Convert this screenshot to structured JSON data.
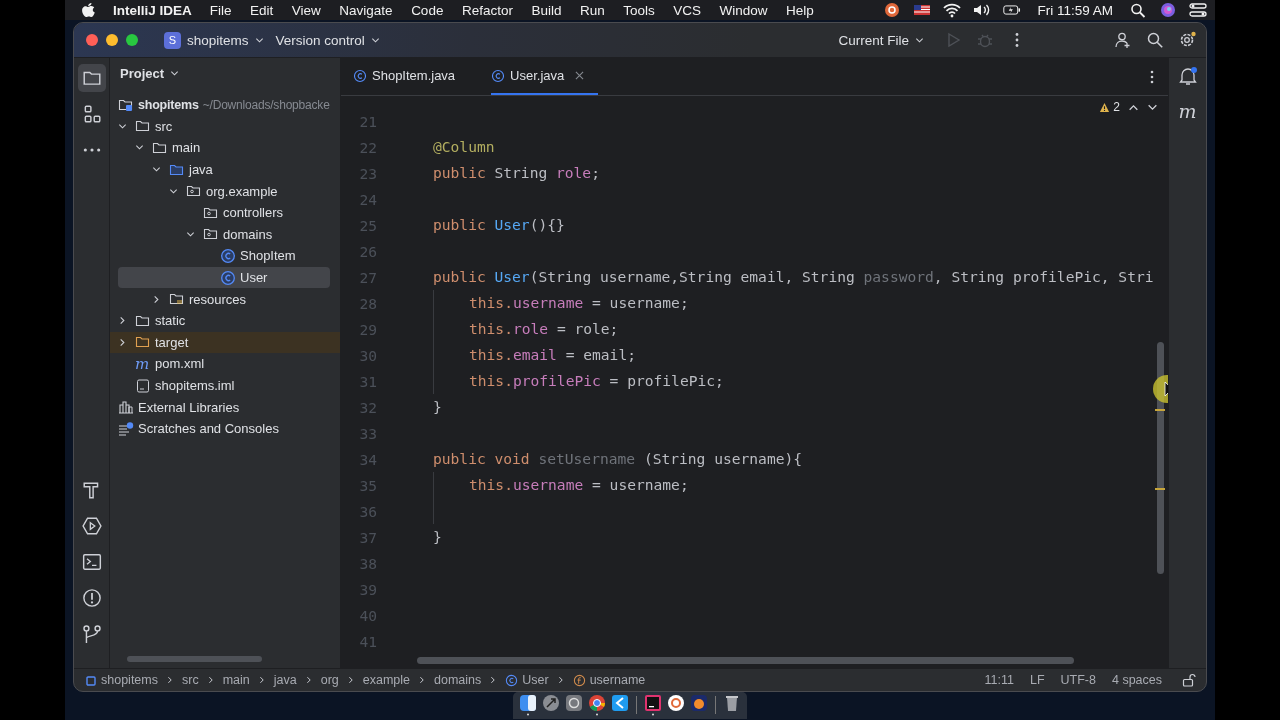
{
  "menu_bar": {
    "app_name": "IntelliJ IDEA",
    "menus": [
      "File",
      "Edit",
      "View",
      "Navigate",
      "Code",
      "Refactor",
      "Build",
      "Run",
      "Tools",
      "VCS",
      "Window",
      "Help"
    ],
    "clock": "Fri 11:59 AM"
  },
  "title_bar": {
    "project_badge": "S",
    "project": "shopitems",
    "vcs": "Version control",
    "run_config": "Current File",
    "run_disabled": true
  },
  "project_panel": {
    "title": "Project",
    "tree": [
      {
        "label": "shopitems",
        "path": "~/Downloads/shopbacke",
        "kind": "module",
        "selected": false,
        "children": [
          {
            "label": "src",
            "kind": "folder",
            "expanded": true,
            "selected": false,
            "children": [
              {
                "label": "main",
                "kind": "folder",
                "expanded": true,
                "selected": false,
                "children": [
                  {
                    "label": "java",
                    "kind": "source",
                    "expanded": true,
                    "selected": false,
                    "children": [
                      {
                        "label": "org.example",
                        "kind": "package",
                        "expanded": true,
                        "selected": false,
                        "children": [
                          {
                            "label": "controllers",
                            "kind": "package",
                            "selected": false
                          },
                          {
                            "label": "domains",
                            "kind": "package",
                            "expanded": true,
                            "selected": false,
                            "children": [
                              {
                                "label": "ShopItem",
                                "kind": "class",
                                "selected": false
                              },
                              {
                                "label": "User",
                                "kind": "class",
                                "selected": true
                              }
                            ]
                          }
                        ]
                      }
                    ]
                  },
                  {
                    "label": "resources",
                    "kind": "resources",
                    "expanded": false,
                    "selected": false
                  }
                ]
              }
            ]
          },
          {
            "label": "static",
            "kind": "folder",
            "expanded": false,
            "selected": false
          },
          {
            "label": "target",
            "kind": "excluded",
            "expanded": false,
            "selected": false
          },
          {
            "label": "pom.xml",
            "kind": "maven",
            "icon_text": "m",
            "selected": false
          },
          {
            "label": "shopitems.iml",
            "kind": "file",
            "selected": false
          }
        ]
      },
      {
        "label": "External Libraries",
        "kind": "library",
        "selected": false
      },
      {
        "label": "Scratches and Consoles",
        "kind": "scratches",
        "selected": false
      }
    ]
  },
  "tabs": [
    {
      "label": "ShopItem.java",
      "selected": false
    },
    {
      "label": "User.java",
      "selected": true
    }
  ],
  "inspections": {
    "warnings": "2"
  },
  "code_lines": [
    {
      "number": "21",
      "indented": false
    },
    {
      "number": "22",
      "indented": false,
      "tokens": [
        {
          "text": "@Column",
          "kind": "annotation"
        }
      ]
    },
    {
      "number": "23",
      "indented": false,
      "tokens": [
        {
          "text": "public",
          "kind": "keyword"
        },
        {
          "text": " String ",
          "kind": "plain"
        },
        {
          "text": "role",
          "kind": "field"
        },
        {
          "text": ";",
          "kind": "plain"
        }
      ]
    },
    {
      "number": "24",
      "indented": false
    },
    {
      "number": "25",
      "indented": false,
      "tokens": [
        {
          "text": "public ",
          "kind": "keyword"
        },
        {
          "text": "User",
          "kind": "constructor"
        },
        {
          "text": "(){}",
          "kind": "plain"
        }
      ]
    },
    {
      "number": "26",
      "indented": false
    },
    {
      "number": "27",
      "indented": false,
      "tokens": [
        {
          "text": "public ",
          "kind": "keyword"
        },
        {
          "text": "User",
          "kind": "constructor"
        },
        {
          "text": "(String username,String email, String ",
          "kind": "plain"
        },
        {
          "text": "password",
          "kind": "unused"
        },
        {
          "text": ", String profilePic, Stri",
          "kind": "plain"
        }
      ]
    },
    {
      "number": "28",
      "indented": true,
      "tokens": [
        {
          "text": "this.",
          "kind": "keyword"
        },
        {
          "text": "username",
          "kind": "field"
        },
        {
          "text": " = username;",
          "kind": "plain"
        }
      ]
    },
    {
      "number": "29",
      "indented": true,
      "tokens": [
        {
          "text": "this.",
          "kind": "keyword"
        },
        {
          "text": "role",
          "kind": "field"
        },
        {
          "text": " = role;",
          "kind": "plain"
        }
      ]
    },
    {
      "number": "30",
      "indented": true,
      "tokens": [
        {
          "text": "this.",
          "kind": "keyword"
        },
        {
          "text": "email",
          "kind": "field"
        },
        {
          "text": " = email;",
          "kind": "plain"
        }
      ]
    },
    {
      "number": "31",
      "indented": true,
      "tokens": [
        {
          "text": "this.",
          "kind": "keyword"
        },
        {
          "text": "profilePic",
          "kind": "field"
        },
        {
          "text": " = profilePic;",
          "kind": "plain"
        }
      ]
    },
    {
      "number": "32",
      "indented": false,
      "tokens": [
        {
          "text": "}",
          "kind": "plain"
        }
      ]
    },
    {
      "number": "33",
      "indented": false
    },
    {
      "number": "34",
      "indented": false,
      "tokens": [
        {
          "text": "public void ",
          "kind": "keyword"
        },
        {
          "text": "setUsername",
          "kind": "unused"
        },
        {
          "text": " (String username){",
          "kind": "plain"
        }
      ]
    },
    {
      "number": "35",
      "indented": true,
      "tokens": [
        {
          "text": "this.",
          "kind": "keyword"
        },
        {
          "text": "username",
          "kind": "field"
        },
        {
          "text": " = username;",
          "kind": "plain"
        }
      ]
    },
    {
      "number": "36",
      "indented": true
    },
    {
      "number": "37",
      "indented": false,
      "tokens": [
        {
          "text": "}",
          "kind": "plain"
        }
      ]
    },
    {
      "number": "38",
      "indented": false
    },
    {
      "number": "39",
      "indented": false
    },
    {
      "number": "40",
      "indented": false
    },
    {
      "number": "41",
      "indented": false
    }
  ],
  "right_strip": {
    "notifications_unread": true,
    "maven_label": "m"
  },
  "breadcrumbs": [
    {
      "label": "shopitems",
      "kind": "module"
    },
    {
      "label": "src",
      "kind": "plain"
    },
    {
      "label": "main",
      "kind": "plain"
    },
    {
      "label": "java",
      "kind": "plain"
    },
    {
      "label": "org",
      "kind": "plain"
    },
    {
      "label": "example",
      "kind": "plain"
    },
    {
      "label": "domains",
      "kind": "plain"
    },
    {
      "label": "User",
      "kind": "class"
    },
    {
      "label": "username",
      "kind": "field"
    }
  ],
  "status": {
    "position": "11:11",
    "line_separator": "LF",
    "encoding": "UTF-8",
    "indent": "4 spaces"
  },
  "dock_apps": [
    {
      "kind": "finder",
      "running": true
    },
    {
      "kind": "launchpad",
      "running": false
    },
    {
      "kind": "settings",
      "running": false
    },
    {
      "kind": "chrome",
      "running": true
    },
    {
      "kind": "vscode",
      "running": false
    },
    {
      "kind": "intellij",
      "running": true
    },
    {
      "kind": "arc",
      "running": false
    },
    {
      "kind": "orange",
      "running": false
    },
    {
      "kind": "trash",
      "running": false
    }
  ]
}
